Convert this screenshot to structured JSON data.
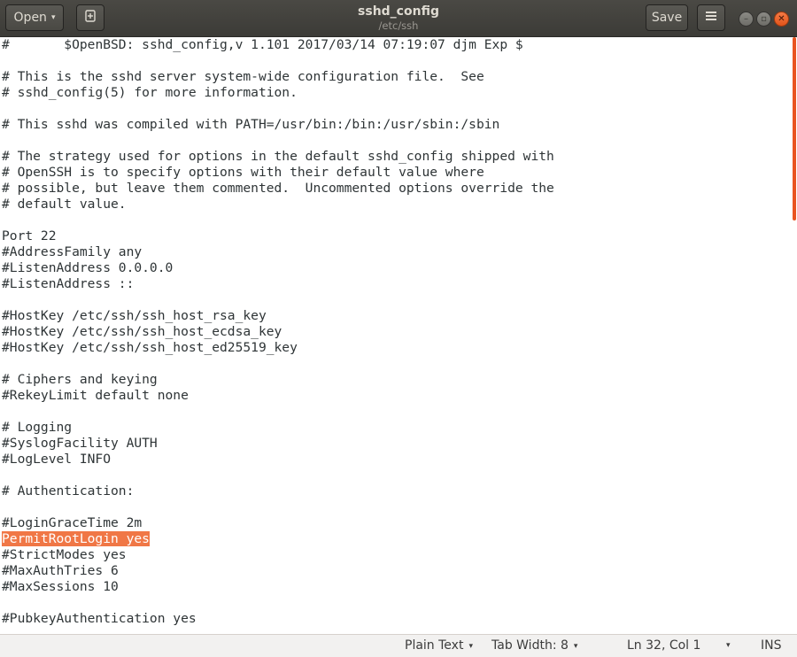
{
  "window": {
    "title": "sshd_config",
    "subtitle": "/etc/ssh"
  },
  "toolbar": {
    "open_label": "Open",
    "open_caret": "▾",
    "pin_icon_glyph": "⎘",
    "save_label": "Save",
    "menu_icon_glyph": "☰",
    "minimize_glyph": "–",
    "maximize_glyph": "▫",
    "close_glyph": "✕"
  },
  "editor": {
    "lines": [
      "#\t$OpenBSD: sshd_config,v 1.101 2017/03/14 07:19:07 djm Exp $",
      "",
      "# This is the sshd server system-wide configuration file.  See",
      "# sshd_config(5) for more information.",
      "",
      "# This sshd was compiled with PATH=/usr/bin:/bin:/usr/sbin:/sbin",
      "",
      "# The strategy used for options in the default sshd_config shipped with",
      "# OpenSSH is to specify options with their default value where",
      "# possible, but leave them commented.  Uncommented options override the",
      "# default value.",
      "",
      "Port 22",
      "#AddressFamily any",
      "#ListenAddress 0.0.0.0",
      "#ListenAddress ::",
      "",
      "#HostKey /etc/ssh/ssh_host_rsa_key",
      "#HostKey /etc/ssh/ssh_host_ecdsa_key",
      "#HostKey /etc/ssh/ssh_host_ed25519_key",
      "",
      "# Ciphers and keying",
      "#RekeyLimit default none",
      "",
      "# Logging",
      "#SyslogFacility AUTH",
      "#LogLevel INFO",
      "",
      "# Authentication:",
      "",
      "#LoginGraceTime 2m",
      "PermitRootLogin yes",
      "#StrictModes yes",
      "#MaxAuthTries 6",
      "#MaxSessions 10",
      "",
      "#PubkeyAuthentication yes"
    ],
    "selected_line_index": 31
  },
  "statusbar": {
    "language": "Plain Text",
    "tab_width": "Tab Width: 8",
    "position": "Ln 32, Col 1",
    "mode": "INS",
    "caret": "▾"
  },
  "colors": {
    "accent": "#e95420",
    "selection": "#f07746",
    "headerbar": "#3c3b37",
    "text": "#2e3436"
  }
}
